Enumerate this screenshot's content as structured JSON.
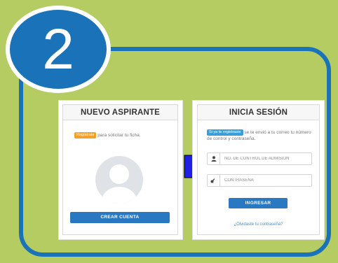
{
  "step": {
    "number": "2"
  },
  "new_applicant": {
    "title": "NUEVO ASPIRANTE",
    "badge": "Regístrate",
    "text": "para solicitar tu ficha.",
    "button": "CREAR CUENTA"
  },
  "login": {
    "title": "INICIA SESIÓN",
    "badge": "Si ya te registraste",
    "info": "se te envió a tu correo tu número de control y contraseña.",
    "control_placeholder": "NO. DE CONTROL DE ADMISIÓN",
    "password_placeholder": "CONTRASEÑA",
    "button": "INGRESAR",
    "forgot": "¿Olvidaste tu contraseña?"
  },
  "colors": {
    "background": "#b5cc63",
    "frame": "#1a72b9",
    "arrow": "#1f1fe6",
    "button": "#2b78c2",
    "badge_orange": "#f4a12a",
    "badge_blue": "#3a9fd8"
  },
  "icons": {
    "user_field": "user-icon",
    "password_field": "key-icon",
    "avatar": "avatar-icon",
    "arrow": "right-arrow-icon"
  }
}
